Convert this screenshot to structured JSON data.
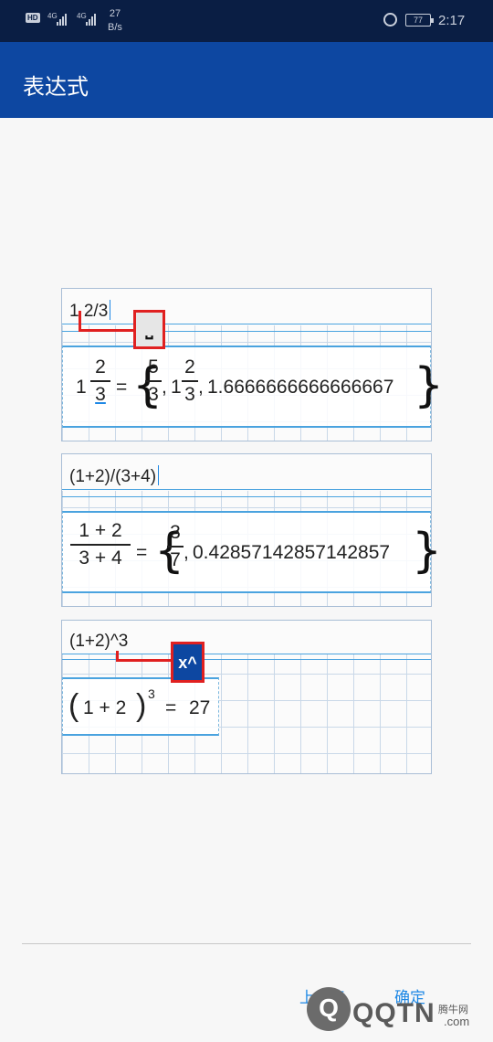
{
  "status_bar": {
    "hd": "HD",
    "sim1": "4G",
    "sim2": "4G",
    "speed_value": "27",
    "speed_unit": "B/s",
    "battery": "77",
    "time": "2:17",
    "alarm_icon": "alarm-clock-icon"
  },
  "appbar": {
    "title": "表达式",
    "color": "#0d47a1"
  },
  "panels": [
    {
      "input": "1 2/3",
      "key_label": "⎵",
      "result": {
        "whole": "1",
        "num": "2",
        "den": "3",
        "eq": "=",
        "r1_num": "5",
        "r1_den": "3",
        "comma1": ",",
        "r2_whole": "1",
        "r2_num": "2",
        "r2_den": "3",
        "comma2": ",",
        "decimal": "1.6666666666666667"
      }
    },
    {
      "input": "(1+2)/(3+4)",
      "result": {
        "num": "1 + 2",
        "den": "3 + 4",
        "eq": "=",
        "r1_num": "3",
        "r1_den": "7",
        "comma1": ",",
        "decimal": "0.42857142857142857"
      }
    },
    {
      "input": "(1+2)^3",
      "key_label": "x^",
      "result": {
        "open": "(",
        "base": "1 + 2",
        "close": ")",
        "exp": "3",
        "eq": "=",
        "value": "27"
      }
    }
  ],
  "footer": {
    "prev_label": "上一步",
    "confirm_label": "确定"
  },
  "watermark": {
    "logo": "Q",
    "text": "QQTN",
    "suffix": ".com",
    "cn": "腾牛网"
  }
}
